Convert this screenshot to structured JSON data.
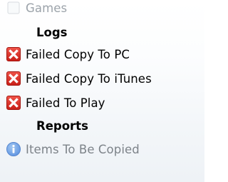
{
  "tree": {
    "games_label": "Games",
    "logs_header": "Logs",
    "logs_items": [
      {
        "label": "Failed Copy To PC",
        "icon": "error-x-icon"
      },
      {
        "label": "Failed Copy To iTunes",
        "icon": "error-x-icon"
      },
      {
        "label": "Failed To Play",
        "icon": "error-x-icon"
      }
    ],
    "reports_header": "Reports",
    "reports_items": [
      {
        "label": "Items To Be Copied",
        "icon": "info-icon"
      }
    ]
  },
  "colors": {
    "error_red": "#e0322b",
    "info_blue": "#3b7ddd"
  }
}
